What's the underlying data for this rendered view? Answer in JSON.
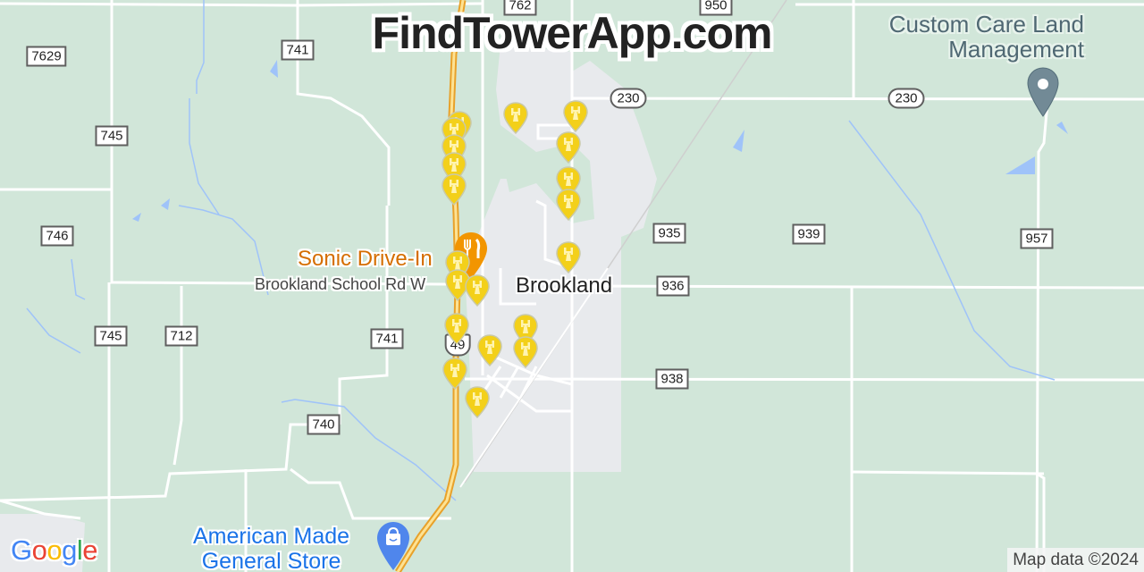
{
  "brand": {
    "title": "FindTowerApp.com"
  },
  "map": {
    "provider_logo": {
      "letters": [
        "G",
        "o",
        "o",
        "g",
        "l",
        "e"
      ],
      "colors": [
        "#4285f4",
        "#ea4335",
        "#fbbc05",
        "#4285f4",
        "#34a853",
        "#ea4335"
      ]
    },
    "attribution": "Map data ©2024",
    "colors": {
      "land": "#d1e6d9",
      "urban": "#e8eaed",
      "water": "#9fc3f9",
      "highway": "#f5a623",
      "tower": "#f3d01a",
      "road": "#ffffff"
    },
    "places": {
      "town": "Brookland",
      "custom_care": {
        "line1": "Custom Care Land",
        "line2": "Management",
        "icon": "place-pin-icon"
      },
      "sonic": {
        "name": "Sonic Drive-In",
        "icon": "restaurant-icon"
      },
      "store": {
        "line1": "American Made",
        "line2": "General Store",
        "icon": "shopping-bag-icon"
      },
      "street": "Brookland School Rd W"
    },
    "route_shields": [
      {
        "id": "r7629",
        "label": "7629",
        "style": "county"
      },
      {
        "id": "r741a",
        "label": "741",
        "style": "county"
      },
      {
        "id": "r762",
        "label": "762",
        "style": "county"
      },
      {
        "id": "r950",
        "label": "950",
        "style": "county"
      },
      {
        "id": "r745a",
        "label": "745",
        "style": "county"
      },
      {
        "id": "r230a",
        "label": "230",
        "style": "state"
      },
      {
        "id": "r230b",
        "label": "230",
        "style": "state"
      },
      {
        "id": "r746",
        "label": "746",
        "style": "county"
      },
      {
        "id": "r935",
        "label": "935",
        "style": "county"
      },
      {
        "id": "r939",
        "label": "939",
        "style": "county"
      },
      {
        "id": "r957",
        "label": "957",
        "style": "county"
      },
      {
        "id": "r936",
        "label": "936",
        "style": "county"
      },
      {
        "id": "r745b",
        "label": "745",
        "style": "county"
      },
      {
        "id": "r712",
        "label": "712",
        "style": "county"
      },
      {
        "id": "r741b",
        "label": "741",
        "style": "county"
      },
      {
        "id": "r49",
        "label": "49",
        "style": "us"
      },
      {
        "id": "r938",
        "label": "938",
        "style": "county"
      },
      {
        "id": "r740",
        "label": "740",
        "style": "county"
      }
    ],
    "tower_markers": {
      "count": 22,
      "icon": "cell-tower-icon"
    }
  }
}
